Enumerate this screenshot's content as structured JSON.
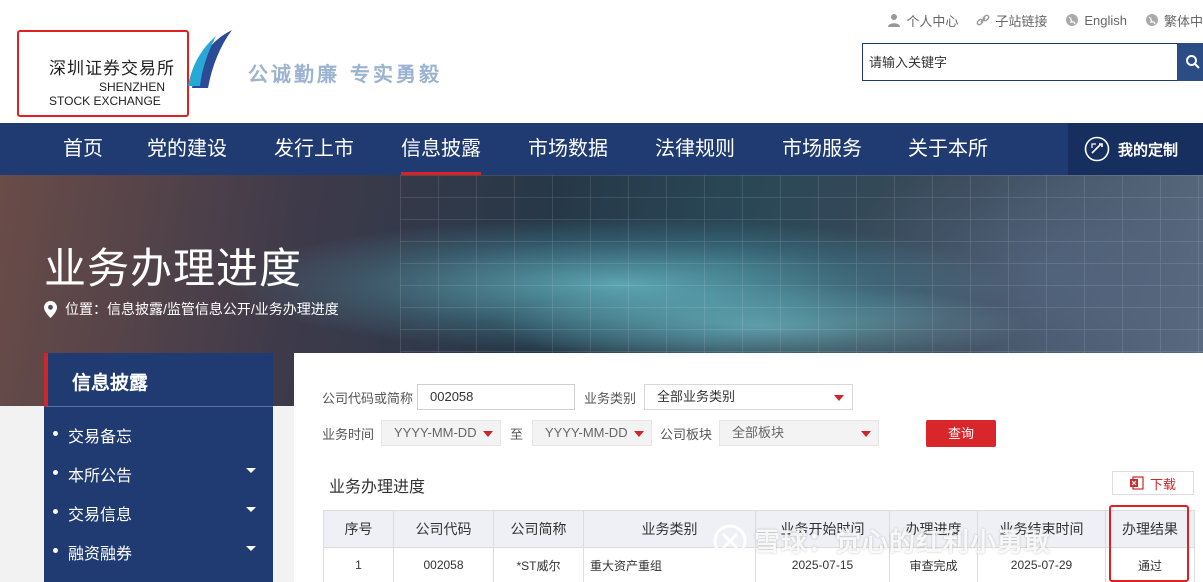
{
  "header": {
    "logo_cn": "深圳证券交易所",
    "logo_en_line1": "SHENZHEN",
    "logo_en_line2": "STOCK EXCHANGE",
    "slogan": "公诚勤廉 专实勇毅",
    "toplinks": [
      {
        "label": "个人中心",
        "icon": "user-icon"
      },
      {
        "label": "子站链接",
        "icon": "link-icon"
      },
      {
        "label": "English",
        "icon": "globe-icon"
      },
      {
        "label": "繁体中",
        "icon": "globe-icon"
      }
    ],
    "search_placeholder": "请输入关键字"
  },
  "nav": {
    "items": [
      "首页",
      "党的建设",
      "发行上市",
      "信息披露",
      "市场数据",
      "法律规则",
      "市场服务",
      "关于本所"
    ],
    "active": "信息披露",
    "custom_label": "我的定制"
  },
  "banner": {
    "title": "业务办理进度",
    "breadcrumb": "位置：信息披露/监管信息公开/业务办理进度"
  },
  "sidebar": {
    "title": "信息披露",
    "items": [
      {
        "label": "交易备忘",
        "has_submenu": false
      },
      {
        "label": "本所公告",
        "has_submenu": true
      },
      {
        "label": "交易信息",
        "has_submenu": true
      },
      {
        "label": "融资融券",
        "has_submenu": true
      },
      {
        "label": "",
        "has_submenu": true
      }
    ]
  },
  "filters": {
    "code_label": "公司代码或简称",
    "code_value": "002058",
    "type_label": "业务类别",
    "type_value": "全部业务类别",
    "time_label": "业务时间",
    "date_from": "YYYY-MM-DD",
    "date_sep": "至",
    "date_to": "YYYY-MM-DD",
    "board_label": "公司板块",
    "board_value": "全部板块",
    "query_label": "查询"
  },
  "section": {
    "title": "业务办理进度",
    "download_label": "下载"
  },
  "table": {
    "headers": [
      "序号",
      "公司代码",
      "公司简称",
      "业务类别",
      "业务开始时间",
      "办理进度",
      "业务结束时间",
      "办理结果"
    ],
    "rows": [
      [
        "1",
        "002058",
        "*ST威尔",
        "重大资产重组",
        "2025-07-15",
        "审查完成",
        "2025-07-29",
        "通过"
      ]
    ]
  },
  "watermark": {
    "text": "雪球：觉心的红利小勇敢"
  },
  "colors": {
    "nav_bg": "#1f3b72",
    "accent_red": "#d9262b",
    "highlight_box": "#e02020"
  }
}
